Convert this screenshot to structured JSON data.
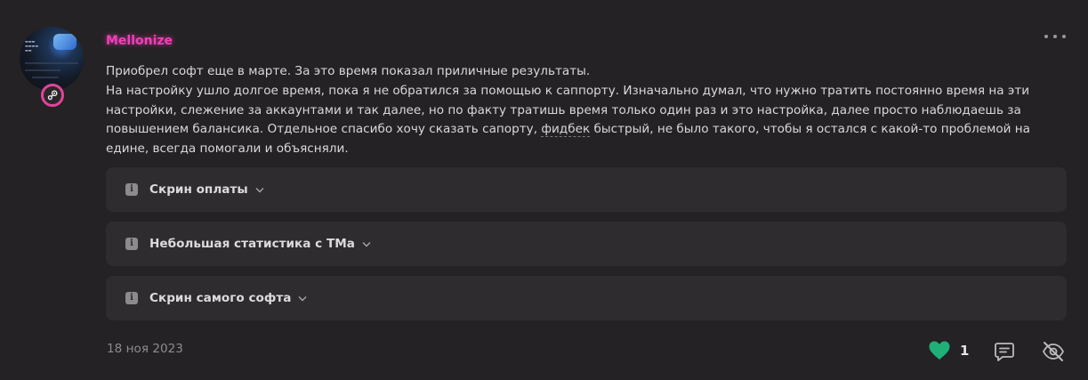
{
  "post": {
    "username": "Mellonize",
    "username_color": "#f03fb9",
    "avatar_badge_icon": "steam-icon",
    "avatar_badge_ring_color": "#e0459b",
    "body": {
      "line1": "Приобрел софт еще в марте. За это время показал приличные результаты.",
      "paragraph_before_link": "На настройку ушло долгое время, пока я не обратился за помощью к саппорту. Изначально думал, что нужно тратить постоянно время на эти\nнастройки, слежение за аккаунтами и так далее, но по факту тратишь время только один раз и это настройка, далее просто наблюдаешь за\nповышением балансика. Отдельное спасибо хочу сказать сапорту, ",
      "underlined_word": "фидбек",
      "paragraph_after_link": " быстрый, не было такого, чтобы я остался с какой-то проблемой на\nедине, всегда помогали и объясняли."
    },
    "spoilers": [
      {
        "label": "Скрин оплаты",
        "icon": "info-icon"
      },
      {
        "label": "Небольшая статистика с ТМа",
        "icon": "info-icon"
      },
      {
        "label": "Скрин самого софта",
        "icon": "info-icon"
      }
    ],
    "date": "18 ноя 2023",
    "likes": {
      "count": "1",
      "icon": "heart-icon",
      "color": "#1fb07a"
    },
    "actions": {
      "reply_icon": "comment-icon",
      "hide_icon": "eye-off-icon",
      "more_icon": "more-dots-icon"
    }
  }
}
